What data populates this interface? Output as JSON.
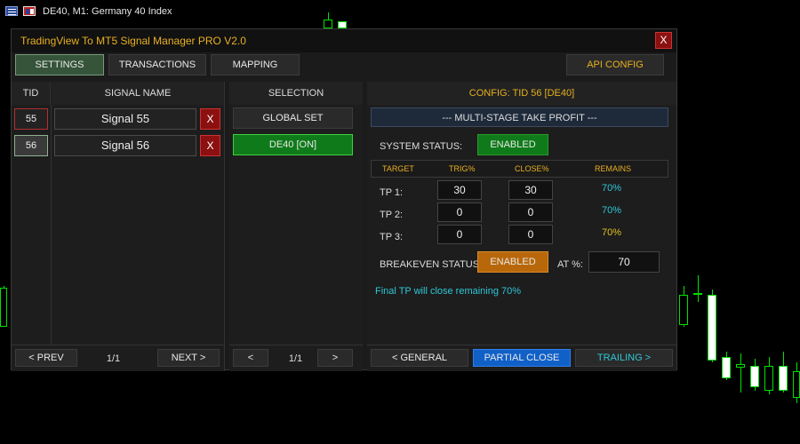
{
  "chart": {
    "title": "DE40, M1:  Germany 40 Index",
    "icons": [
      "chart-menu-icon",
      "symbol-flag-icon"
    ]
  },
  "window": {
    "title": "TradingView To MT5 Signal Manager PRO V2.0",
    "close_label": "X"
  },
  "tabs": {
    "settings": "SETTINGS",
    "transactions": "TRANSACTIONS",
    "mapping": "MAPPING",
    "api_config": "API CONFIG"
  },
  "signals": {
    "col_tid": "TID",
    "col_name": "SIGNAL NAME",
    "rows": [
      {
        "tid": "55",
        "name": "Signal 55",
        "delete": "X"
      },
      {
        "tid": "56",
        "name": "Signal 56",
        "delete": "X"
      }
    ],
    "prev": "< PREV",
    "page": "1/1",
    "next": "NEXT >"
  },
  "selection": {
    "header": "SELECTION",
    "global_set": "GLOBAL SET",
    "active_item": "DE40 [ON]",
    "prev": "<",
    "page": "1/1",
    "next": ">"
  },
  "config": {
    "header": "CONFIG: TID 56 [DE40]",
    "section_title": "--- MULTI-STAGE TAKE PROFIT ---",
    "system_status_label": "SYSTEM STATUS:",
    "system_status_value": "ENABLED",
    "table_headers": {
      "target": "TARGET",
      "trig": "TRIG%",
      "close": "CLOSE%",
      "remains": "REMAINS"
    },
    "tp_rows": [
      {
        "label": "TP 1:",
        "trig": "30",
        "close": "30",
        "remains": "70%",
        "remains_color": "#2ec7d6"
      },
      {
        "label": "TP 2:",
        "trig": "0",
        "close": "0",
        "remains": "70%",
        "remains_color": "#2ec7d6"
      },
      {
        "label": "TP 3:",
        "trig": "0",
        "close": "0",
        "remains": "70%",
        "remains_color": "#e0c020"
      }
    ],
    "breakeven_label": "BREAKEVEN STATUS:",
    "breakeven_value": "ENABLED",
    "at_label": "AT %:",
    "at_value": "70",
    "final_note": "Final TP will close remaining 70%",
    "nav": {
      "general": "< GENERAL",
      "partial_close": "PARTIAL CLOSE",
      "trailing": "TRAILING >"
    }
  },
  "colors": {
    "accent_gold": "#e8b020",
    "enabled_green": "#0f7a1a",
    "enabled_orange": "#b8680a",
    "active_blue": "#1060c8",
    "cyan_text": "#2ec7d6"
  }
}
